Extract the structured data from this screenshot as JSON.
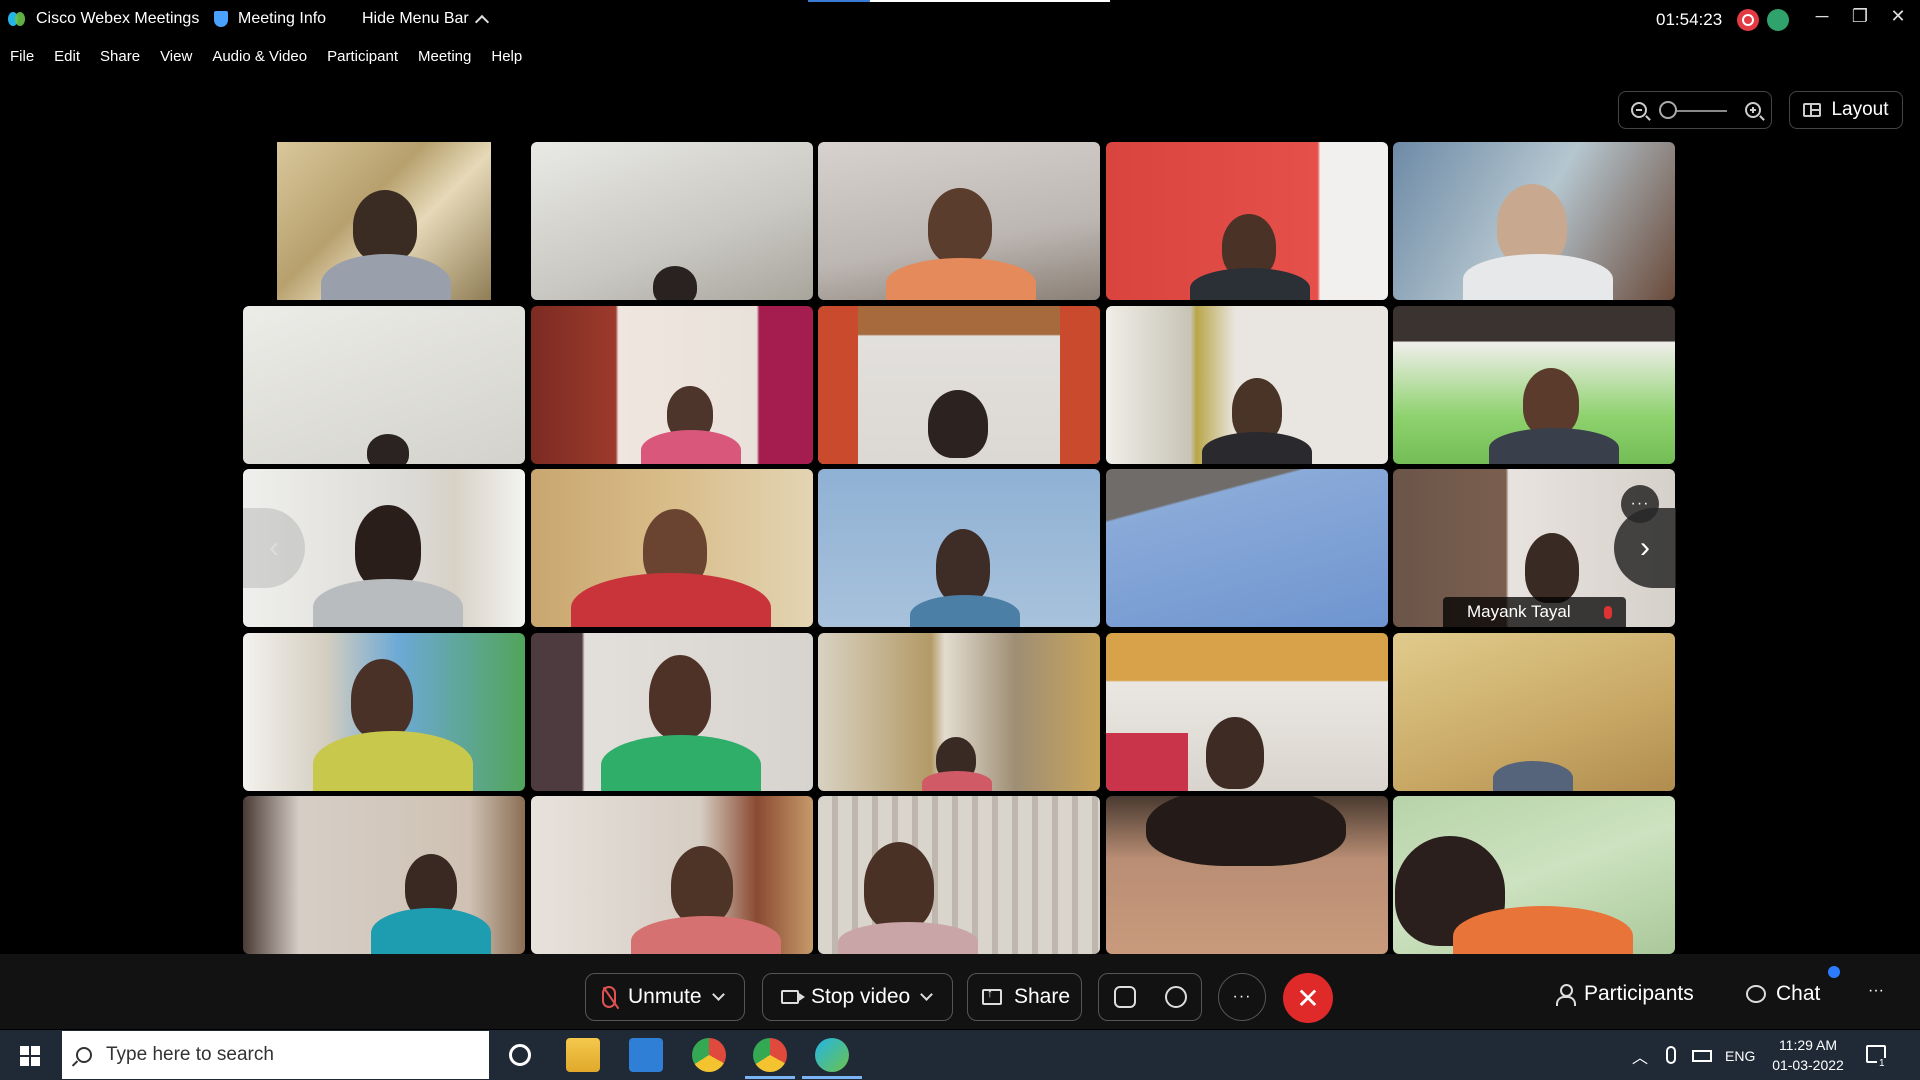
{
  "titlebar": {
    "app_title": "Cisco Webex Meetings",
    "meeting_info": "Meeting Info",
    "hide_menu": "Hide Menu Bar",
    "timer": "01:54:23",
    "minimize": "─",
    "restore": "❐",
    "close": "✕"
  },
  "menu": {
    "items": [
      "File",
      "Edit",
      "Share",
      "View",
      "Audio & Video",
      "Participant",
      "Meeting",
      "Help"
    ]
  },
  "view": {
    "layout_label": "Layout"
  },
  "tiles": {
    "named_participant": "Mayank Tayal",
    "more_label": "···",
    "prev_arrow": "‹",
    "next_arrow": "›"
  },
  "controls": {
    "unmute": "Unmute",
    "stop_video": "Stop video",
    "share": "Share",
    "more": "···",
    "leave": "✕",
    "participants": "Participants",
    "chat": "Chat",
    "overflow": "···"
  },
  "taskbar": {
    "search_placeholder": "Type here to search",
    "language": "ENG",
    "time": "11:29 AM",
    "date": "01-03-2022",
    "notification_count": "1",
    "tray_chevron": "︿"
  },
  "colors": {
    "leave": "#e02a2a",
    "recording": "#e23b44",
    "accent": "#2b7cff"
  }
}
